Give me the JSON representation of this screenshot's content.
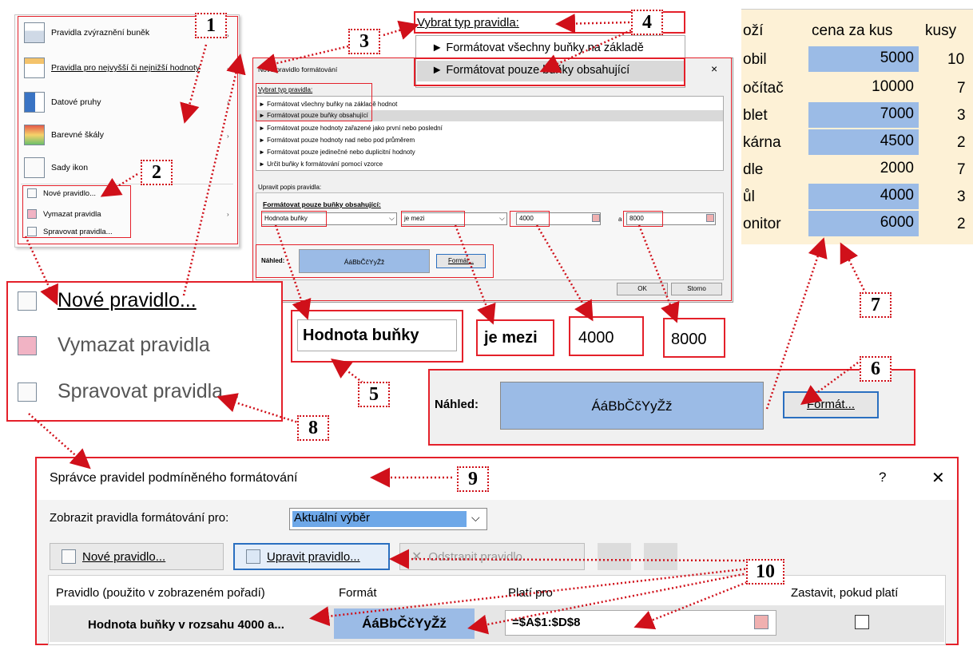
{
  "menu": {
    "items": [
      {
        "label": "Pravidla zvýraznění buněk",
        "submenu": true
      },
      {
        "label": "Pravidla pro nejvyšší či nejnižší hodnoty",
        "submenu": true
      },
      {
        "label": "Datové pruhy",
        "submenu": true
      },
      {
        "label": "Barevné škály",
        "submenu": true
      },
      {
        "label": "Sady ikon",
        "submenu": true
      }
    ],
    "small_items": [
      {
        "label": "Nové pravidlo..."
      },
      {
        "label": "Vymazat pravidla",
        "submenu": true
      },
      {
        "label": "Spravovat pravidla..."
      }
    ]
  },
  "zoom_menu": {
    "items": [
      "Nové pravidlo...",
      "Vymazat pravidla",
      "Spravovat pravidla..."
    ]
  },
  "dialog": {
    "title": "Nové pravidlo formátování",
    "close": "×",
    "section_type_label": "Vybrat typ pravidla:",
    "rule_types": [
      "► Formátovat všechny buňky na základě hodnot",
      "► Formátovat pouze buňky obsahující",
      "► Formátovat pouze hodnoty zařazené jako první nebo poslední",
      "► Formátovat pouze hodnoty nad nebo pod průměrem",
      "► Formátovat pouze jedinečné nebo duplicitní hodnoty",
      "► Určit buňky k formátování pomocí vzorce"
    ],
    "section_desc_label": "Upravit popis pravidla:",
    "desc_title": "Formátovat pouze buňky obsahující:",
    "cond_field": "Hodnota buňky",
    "op_field": "je mezi",
    "value1": "4000",
    "and_label": "a",
    "value2": "8000",
    "preview_label": "Náhled:",
    "preview_text": "ÁáBbČčYyŽž",
    "format_button": "Formát...",
    "ok": "OK",
    "cancel": "Storno"
  },
  "zoom_type": {
    "label": "Vybrat typ pravidla:",
    "line1": "► Formátovat všechny buňky na základě",
    "line2": "► Formátovat pouze buňky obsahující"
  },
  "zoom_fields": {
    "cond": "Hodnota buňky",
    "op": "je mezi",
    "v1": "4000",
    "v2": "8000"
  },
  "zoom_preview": {
    "label": "Náhled:",
    "text": "ÁáBbČčYyŽž",
    "button": "Formát..."
  },
  "sheet": {
    "headers": [
      "oží",
      "cena za kus",
      "kusy"
    ],
    "rows": [
      {
        "name": "obil",
        "price": "5000",
        "qty": "10",
        "hl": true
      },
      {
        "name": "očítač",
        "price": "10000",
        "qty": "7",
        "hl": false
      },
      {
        "name": "blet",
        "price": "7000",
        "qty": "3",
        "hl": true
      },
      {
        "name": "kárna",
        "price": "4500",
        "qty": "2",
        "hl": true
      },
      {
        "name": "dle",
        "price": "2000",
        "qty": "7",
        "hl": false
      },
      {
        "name": "ůl",
        "price": "4000",
        "qty": "3",
        "hl": true
      },
      {
        "name": "onitor",
        "price": "6000",
        "qty": "2",
        "hl": true
      }
    ],
    "colors": {
      "bg": "#fdf1d6",
      "highlight": "#9bbbe6"
    }
  },
  "manager": {
    "title": "Správce pravidel podmíněného formátování",
    "help": "?",
    "close": "✕",
    "show_label": "Zobrazit pravidla formátování pro:",
    "show_value": "Aktuální výběr",
    "new_rule": "Nové pravidlo...",
    "edit_rule": "Upravit pravidlo...",
    "delete_rule": "Odstranit pravidlo",
    "columns": [
      "Pravidlo (použito v zobrazeném pořadí)",
      "Formát",
      "Platí pro",
      "Zastavit, pokud platí"
    ],
    "row": {
      "rule": "Hodnota buňky v rozsahu 4000 a...",
      "format": "ÁáBbČčYyŽž",
      "applies": "=$A$1:$D$8"
    }
  },
  "callouts": [
    "1",
    "2",
    "3",
    "4",
    "5",
    "6",
    "7",
    "8",
    "9",
    "10"
  ]
}
